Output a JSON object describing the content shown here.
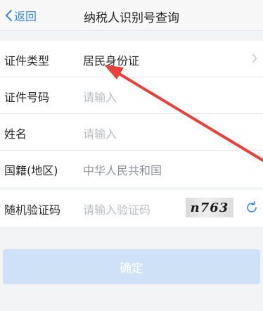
{
  "navbar": {
    "back_label": "返回",
    "title": "纳税人识别号查询"
  },
  "form": {
    "rows": [
      {
        "label": "证件类型",
        "value": "居民身份证"
      },
      {
        "label": "证件号码",
        "placeholder": "请输入"
      },
      {
        "label": "姓名",
        "placeholder": "请输入"
      },
      {
        "label": "国籍(地区)",
        "value": "中华人民共和国"
      }
    ],
    "captcha": {
      "label": "随机验证码",
      "placeholder": "请输入验证码",
      "image_text": "n763"
    }
  },
  "confirm_label": "确定",
  "colors": {
    "accent": "#3a86e8",
    "confirm_disabled": "#cfe1f7",
    "annotation_arrow": "#e8403a"
  },
  "icons": [
    "chevron-left-icon",
    "chevron-right-icon",
    "refresh-icon"
  ]
}
